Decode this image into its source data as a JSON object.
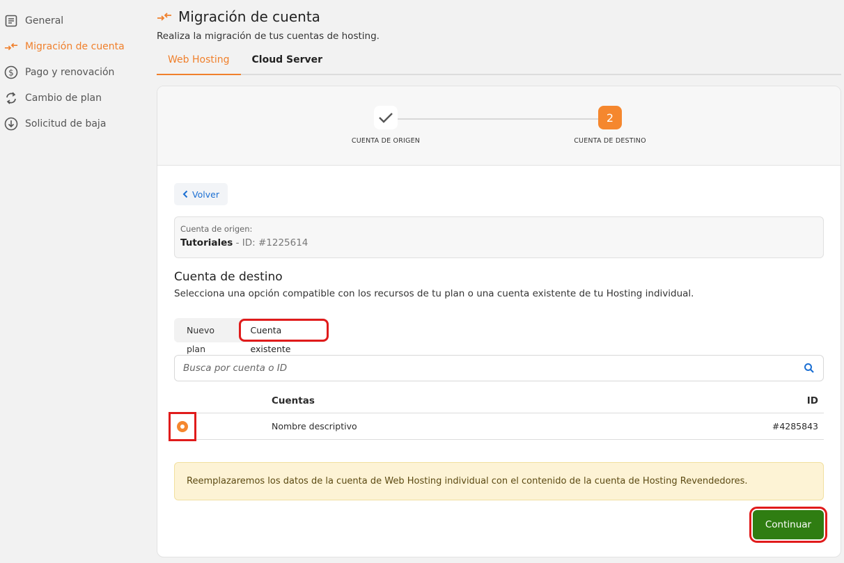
{
  "sidebar": {
    "items": [
      {
        "label": "General",
        "icon": "document-icon"
      },
      {
        "label": "Migración de cuenta",
        "icon": "migrate-arrows-icon"
      },
      {
        "label": "Pago y renovación",
        "icon": "dollar-icon"
      },
      {
        "label": "Cambio de plan",
        "icon": "refresh-icon"
      },
      {
        "label": "Solicitud de baja",
        "icon": "download-circle-icon"
      }
    ]
  },
  "header": {
    "title": "Migración de cuenta",
    "subtitle": "Realiza la migración de tus cuentas de hosting."
  },
  "tabs": [
    {
      "label": "Web Hosting"
    },
    {
      "label": "Cloud Server"
    }
  ],
  "stepper": {
    "steps": [
      {
        "label": "CUENTA DE ORIGEN",
        "state": "done"
      },
      {
        "label": "CUENTA DE DESTINO",
        "number": "2",
        "state": "current"
      }
    ]
  },
  "back_button": "Volver",
  "origin": {
    "caption": "Cuenta de origen:",
    "name": "Tutoriales",
    "id_text": " - ID: #1225614"
  },
  "destination": {
    "title": "Cuenta de destino",
    "description": "Selecciona una opción compatible con los recursos de tu plan o una cuenta existente de tu Hosting individual.",
    "options": [
      "Nuevo plan",
      "Cuenta existente"
    ]
  },
  "search": {
    "placeholder": "Busca por cuenta o ID"
  },
  "table": {
    "headers": {
      "account": "Cuentas",
      "id": "ID"
    },
    "rows": [
      {
        "account": "Nombre descriptivo",
        "id": "#4285843",
        "selected": true
      }
    ]
  },
  "notice": "Reemplazaremos los datos de la cuenta de Web Hosting individual con el contenido de la cuenta de Hosting Revendedores.",
  "continue_button": "Continuar",
  "colors": {
    "accent": "#f5872e",
    "primary_button": "#2f7d12",
    "link": "#1b6fd3",
    "highlight": "#e01b1b"
  }
}
